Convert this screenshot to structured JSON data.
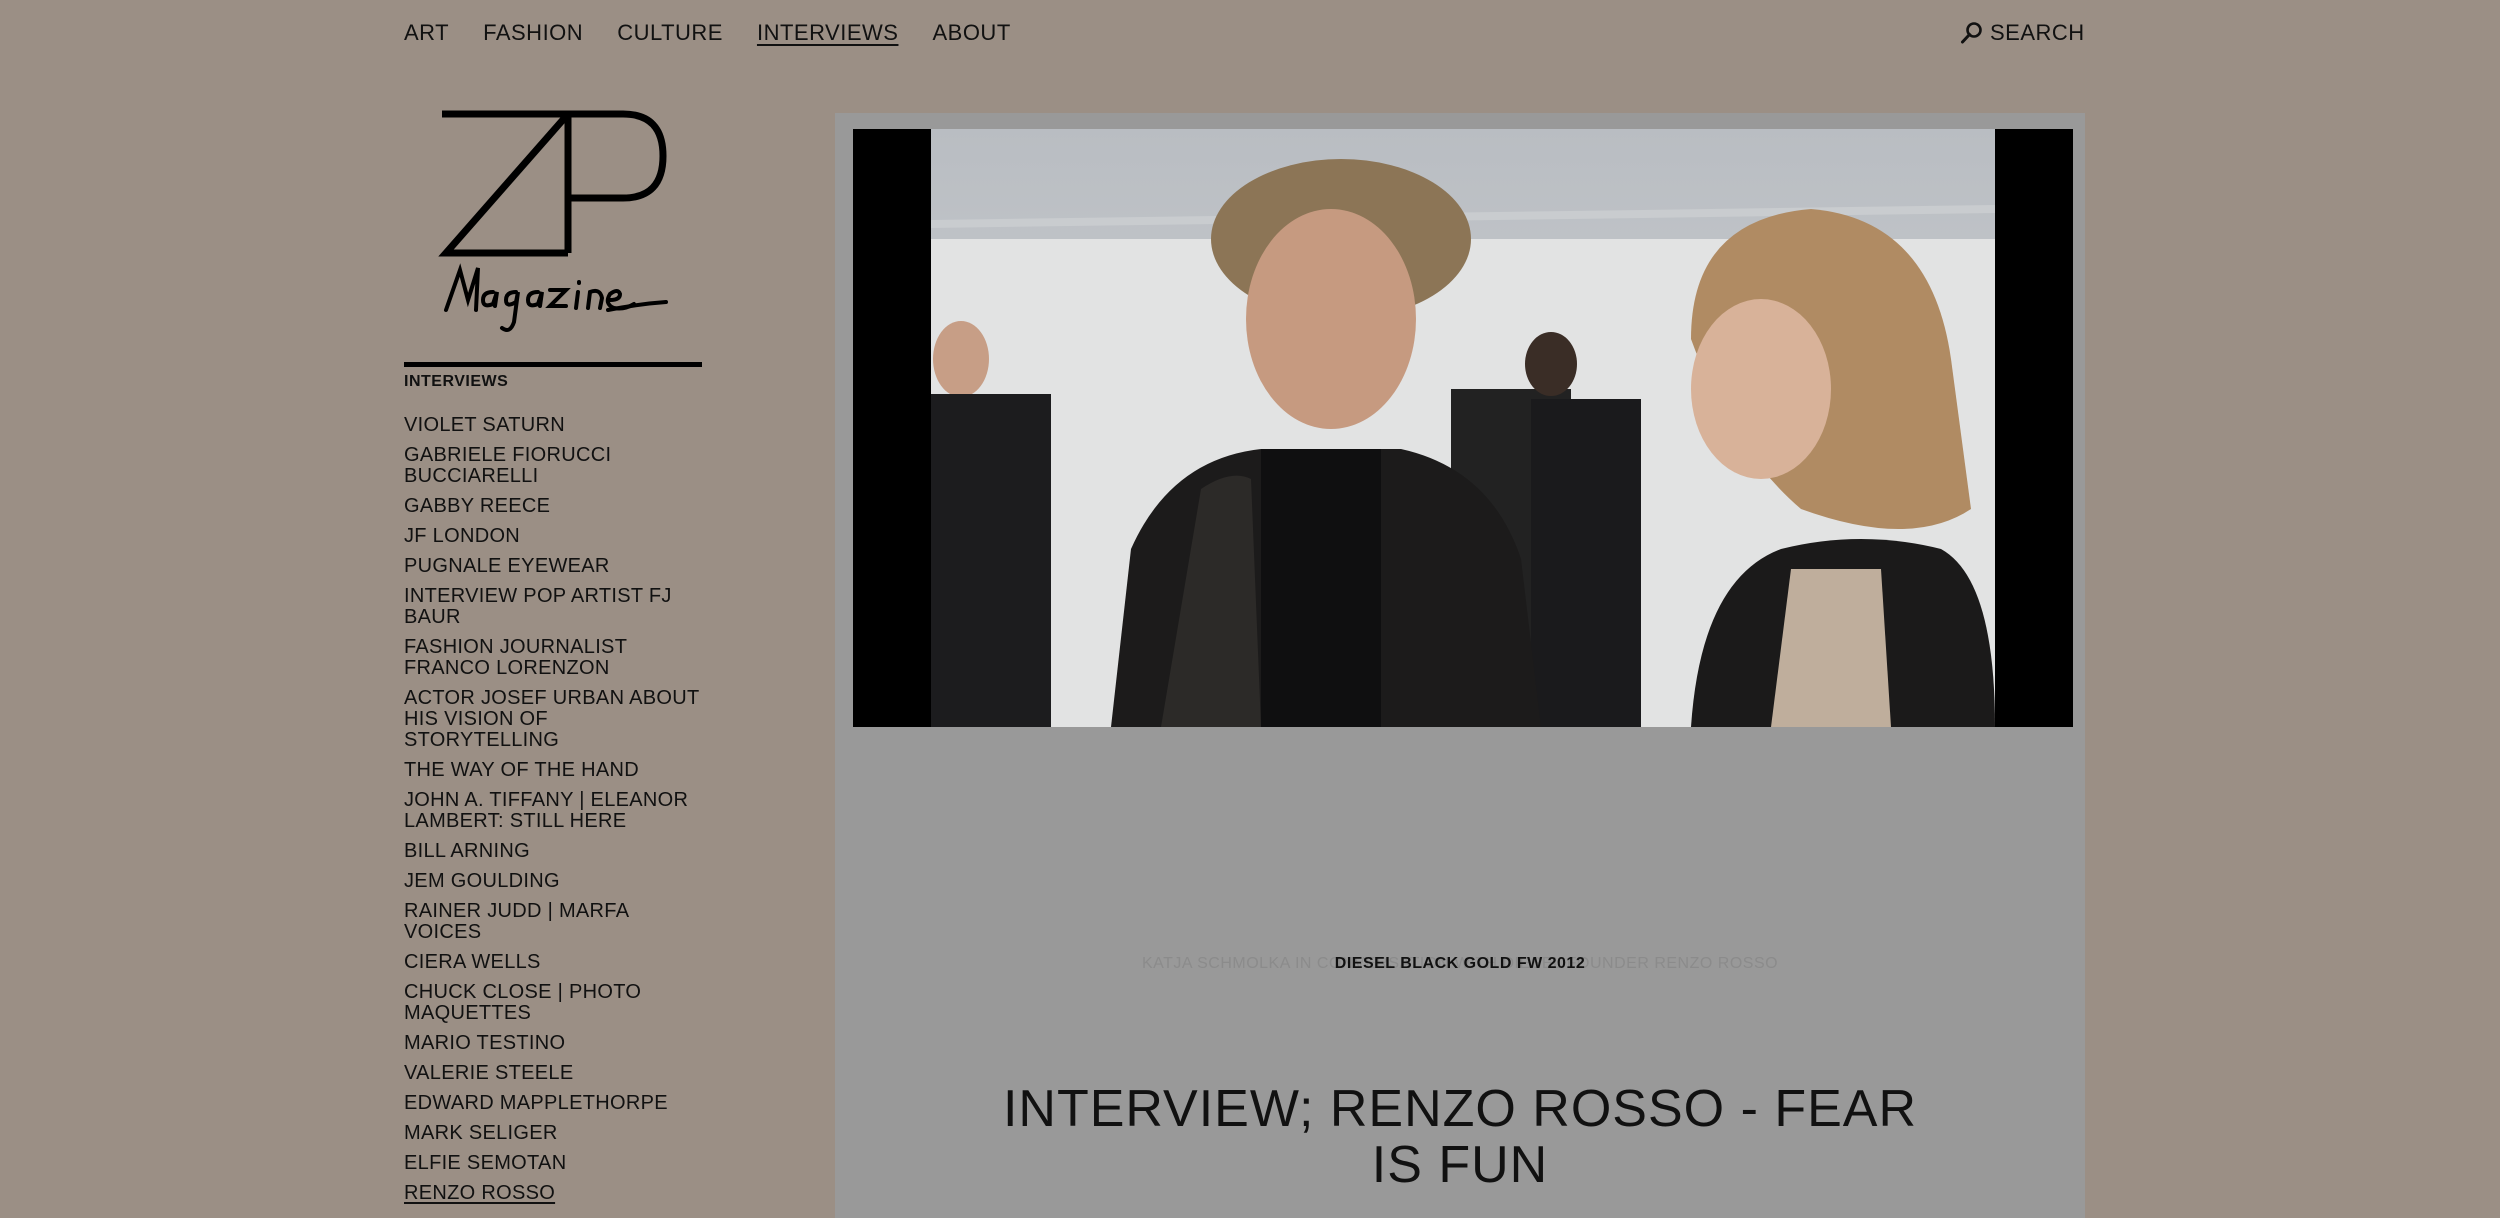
{
  "nav": {
    "items": [
      {
        "label": "ART",
        "active": false
      },
      {
        "label": "FASHION",
        "active": false
      },
      {
        "label": "CULTURE",
        "active": false
      },
      {
        "label": "INTERVIEWS",
        "active": true
      },
      {
        "label": "ABOUT",
        "active": false
      }
    ],
    "search_label": "SEARCH"
  },
  "sidebar": {
    "heading": "INTERVIEWS",
    "items": [
      {
        "label": "VIOLET SATURN"
      },
      {
        "label": "GABRIELE FIORUCCI BUCCIARELLI"
      },
      {
        "label": "GABBY REECE"
      },
      {
        "label": "JF LONDON"
      },
      {
        "label": "PUGNALE EYEWEAR"
      },
      {
        "label": "INTERVIEW POP ARTIST FJ BAUR"
      },
      {
        "label": "FASHION JOURNALIST FRANCO LORENZON"
      },
      {
        "label": "ACTOR JOSEF URBAN ABOUT HIS VISION OF STORYTELLING"
      },
      {
        "label": "THE WAY OF THE HAND"
      },
      {
        "label": "JOHN A. TIFFANY | ELEANOR LAMBERT: STILL HERE"
      },
      {
        "label": "BILL ARNING"
      },
      {
        "label": "JEM GOULDING"
      },
      {
        "label": "RAINER JUDD | MARFA VOICES"
      },
      {
        "label": "CIERA WELLS"
      },
      {
        "label": "CHUCK CLOSE | PHOTO MAQUETTES"
      },
      {
        "label": "MARIO TESTINO"
      },
      {
        "label": "VALERIE STEELE"
      },
      {
        "label": "EDWARD MAPPLETHORPE"
      },
      {
        "label": "MARK SELIGER"
      },
      {
        "label": "ELFIE SEMOTAN"
      },
      {
        "label": "RENZO ROSSO",
        "active": true
      }
    ]
  },
  "main": {
    "caption_faded": "KATJA SCHMOLKA IN CONVERSATION WITH DIESEL FOUNDER RENZO ROSSO",
    "caption": "DIESEL BLACK GOLD FW 2012",
    "title": "INTERVIEW; RENZO ROSSO - FEAR IS FUN"
  },
  "colors": {
    "page_bg": "#9b8f85",
    "panel_bg": "#999999",
    "text": "#111111"
  }
}
